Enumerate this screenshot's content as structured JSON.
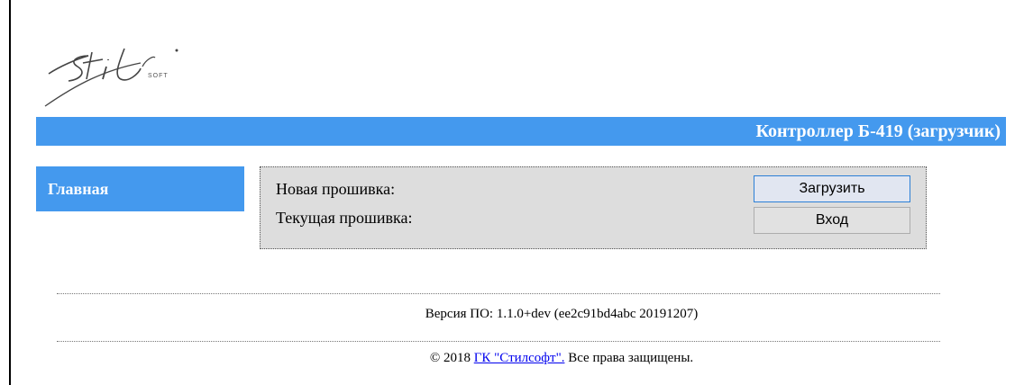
{
  "logo": {
    "icon": "stilsoft-logo-icon",
    "text": "Stil",
    "subtext": "SOFT"
  },
  "header": {
    "title": "Контроллер Б-419 (загрузчик)",
    "color": "#4499ee"
  },
  "nav": {
    "main_label": "Главная"
  },
  "firmware": {
    "new_label": "Новая прошивка:",
    "current_label": "Текущая прошивка:",
    "upload_button": "Загрузить",
    "login_button": "Вход"
  },
  "footer": {
    "version_text": "Версия ПО: 1.1.0+dev (ee2c91bd4abc 20191207)",
    "copyright_prefix": "© 2018 ",
    "company_link": "ГК \"Стилсофт\".",
    "copyright_suffix": " Все права защищены."
  }
}
